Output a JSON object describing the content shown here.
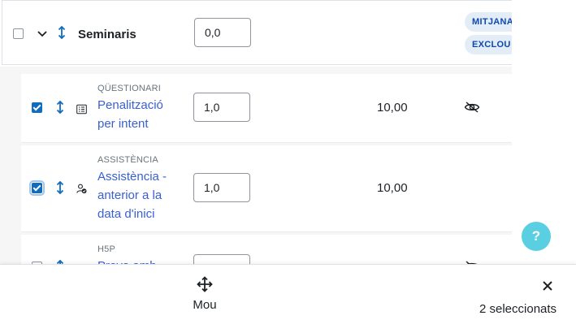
{
  "category": {
    "title": "Seminaris",
    "weight": "0,0",
    "badges": [
      "MITJANA",
      "EXCLOU"
    ]
  },
  "items": [
    {
      "kind": "QÜESTIONARI",
      "name_lines": [
        "Penalització",
        "per intent"
      ],
      "weight": "1,0",
      "grade": "10,00",
      "checked": true,
      "hidden_icon": true
    },
    {
      "kind": "ASSISTÈNCIA",
      "name_lines": [
        "Assistència -",
        "anterior a la",
        "data d'inici"
      ],
      "weight": "1,0",
      "grade": "10,00",
      "checked": true,
      "hidden_icon": false
    },
    {
      "kind": "H5P",
      "name_lines": [
        "Prova amb"
      ],
      "weight": "",
      "grade": "",
      "checked": false,
      "hidden_icon": true
    }
  ],
  "help": {
    "label": "?"
  },
  "bottom_bar": {
    "move_label": "Mou",
    "selected_count": "2 seleccionats"
  },
  "colors": {
    "accent": "#0f6cbf",
    "link": "#3a5fd0",
    "badge_bg": "#e3edf8",
    "help_bg": "#5bcfe2"
  },
  "icons": [
    "move-vertical-icon",
    "chevron-down-icon",
    "quiz-icon",
    "attendance-icon",
    "eye-slash-icon",
    "move-arrows-icon",
    "close-icon"
  ]
}
